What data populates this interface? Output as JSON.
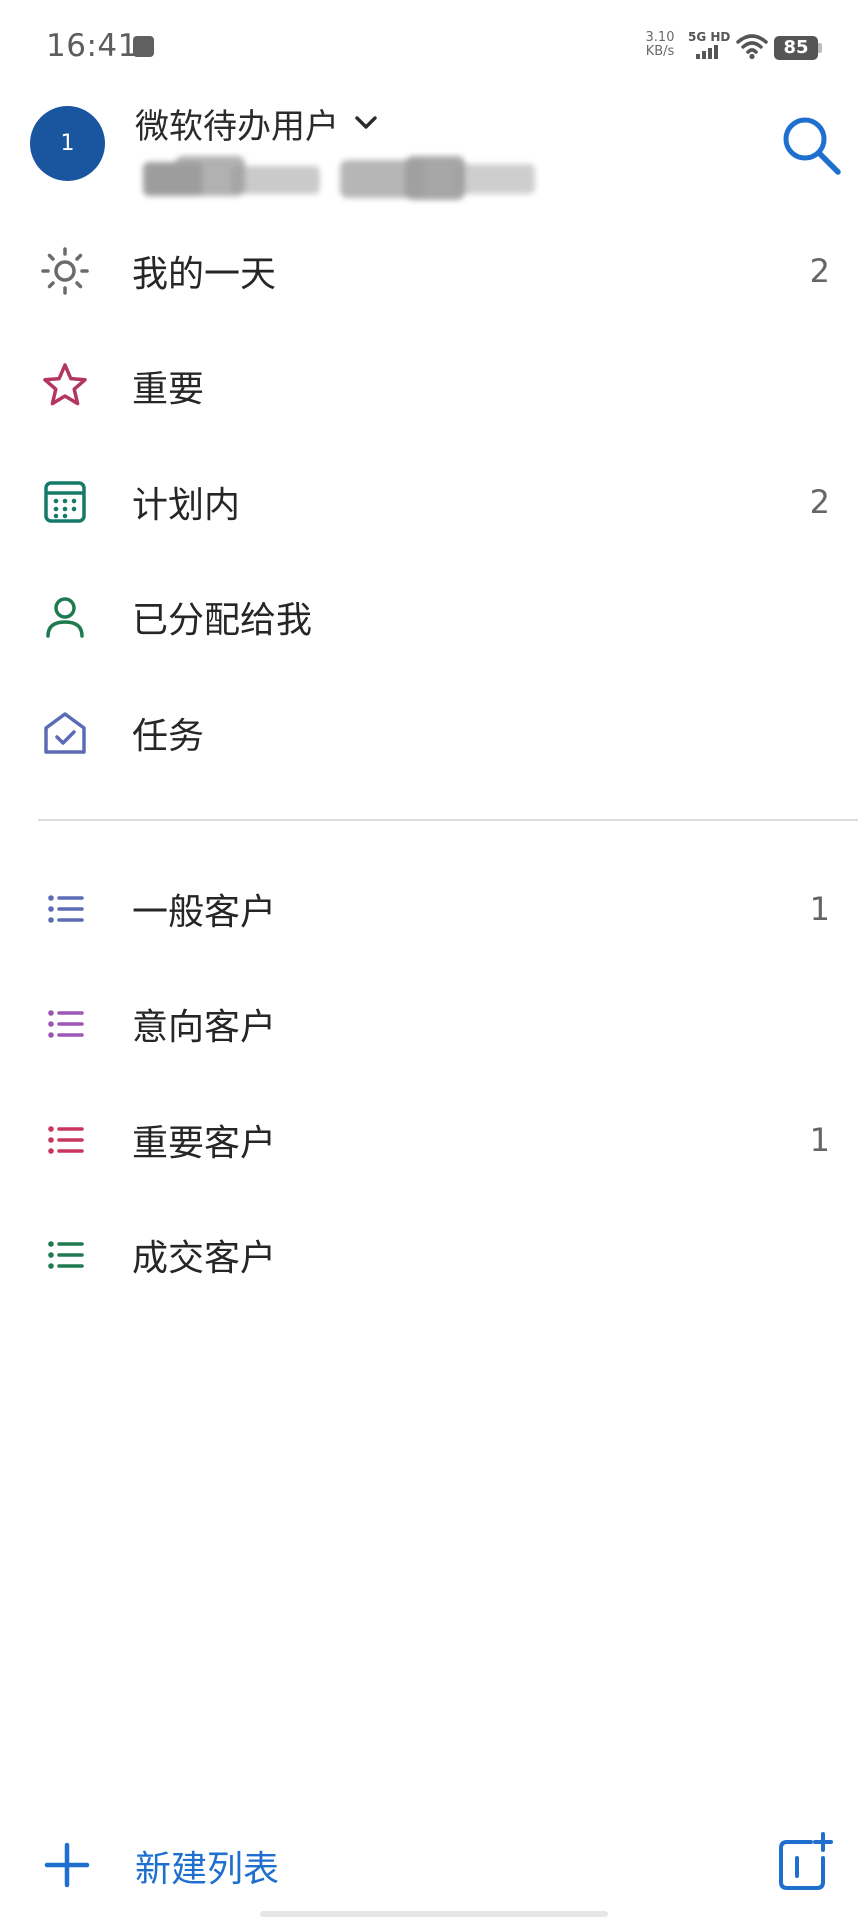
{
  "status_bar": {
    "time": "16:41",
    "network_speed_value": "3.10",
    "network_speed_unit": "KB/s",
    "network_type": "5G HD",
    "battery": "85"
  },
  "account": {
    "avatar_text": "1",
    "name": "微软待办用户"
  },
  "smart_lists": [
    {
      "label": "我的一天",
      "count": "2",
      "icon": "sun-icon",
      "color": "#6b6b6b"
    },
    {
      "label": "重要",
      "count": "",
      "icon": "star-icon",
      "color": "#b2365f"
    },
    {
      "label": "计划内",
      "count": "2",
      "icon": "calendar-icon",
      "color": "#167a6b"
    },
    {
      "label": "已分配给我",
      "count": "",
      "icon": "person-icon",
      "color": "#1f7a4f"
    },
    {
      "label": "任务",
      "count": "",
      "icon": "home-check-icon",
      "color": "#5b6bb5"
    }
  ],
  "custom_lists": [
    {
      "label": "一般客户",
      "count": "1",
      "icon": "list-icon",
      "color": "#5b6bb5"
    },
    {
      "label": "意向客户",
      "count": "",
      "icon": "list-icon",
      "color": "#9c56b5"
    },
    {
      "label": "重要客户",
      "count": "1",
      "icon": "list-icon",
      "color": "#c7365f"
    },
    {
      "label": "成交客户",
      "count": "",
      "icon": "list-icon",
      "color": "#1f7a4f"
    }
  ],
  "footer": {
    "new_list_label": "新建列表",
    "accent_color": "#1f6fcf"
  }
}
